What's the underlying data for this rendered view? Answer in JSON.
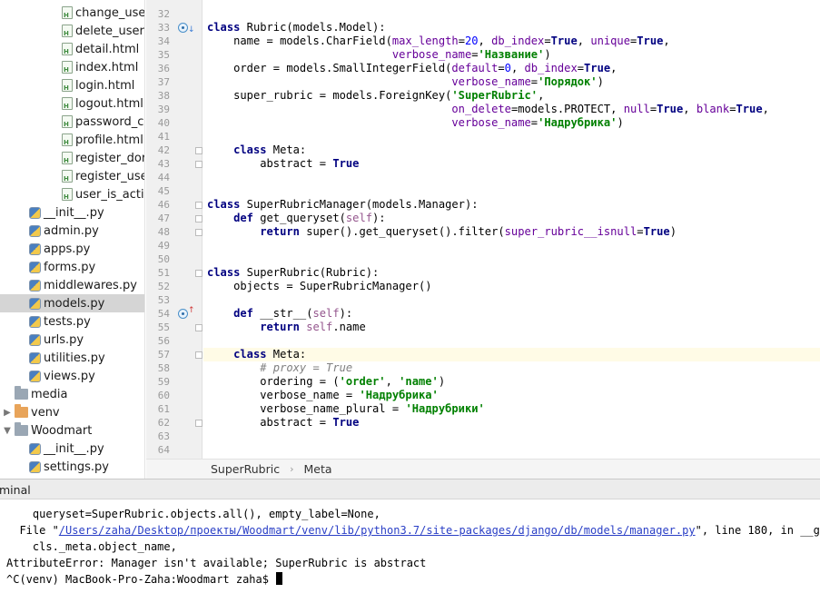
{
  "project_tree": {
    "items": [
      {
        "label": "change_use",
        "type": "html",
        "indent": 3
      },
      {
        "label": "delete_user.",
        "type": "html",
        "indent": 3
      },
      {
        "label": "detail.html",
        "type": "html",
        "indent": 3
      },
      {
        "label": "index.html",
        "type": "html",
        "indent": 3
      },
      {
        "label": "login.html",
        "type": "html",
        "indent": 3
      },
      {
        "label": "logout.html",
        "type": "html",
        "indent": 3
      },
      {
        "label": "password_c",
        "type": "html",
        "indent": 3
      },
      {
        "label": "profile.html",
        "type": "html",
        "indent": 3
      },
      {
        "label": "register_dor",
        "type": "html",
        "indent": 3
      },
      {
        "label": "register_use",
        "type": "html",
        "indent": 3
      },
      {
        "label": "user_is_activ",
        "type": "html",
        "indent": 3
      },
      {
        "label": "__init__.py",
        "type": "py",
        "indent": 2
      },
      {
        "label": "admin.py",
        "type": "py",
        "indent": 2
      },
      {
        "label": "apps.py",
        "type": "py",
        "indent": 2
      },
      {
        "label": "forms.py",
        "type": "py",
        "indent": 2
      },
      {
        "label": "middlewares.py",
        "type": "py",
        "indent": 2
      },
      {
        "label": "models.py",
        "type": "py",
        "indent": 2,
        "selected": true
      },
      {
        "label": "tests.py",
        "type": "py",
        "indent": 2
      },
      {
        "label": "urls.py",
        "type": "py",
        "indent": 2
      },
      {
        "label": "utilities.py",
        "type": "py",
        "indent": 2
      },
      {
        "label": "views.py",
        "type": "py",
        "indent": 2
      },
      {
        "label": "media",
        "type": "folder",
        "indent": 1,
        "arrow": ""
      },
      {
        "label": "venv",
        "type": "folder-orange",
        "indent": 1,
        "arrow": "▶"
      },
      {
        "label": "Woodmart",
        "type": "folder",
        "indent": 1,
        "arrow": "▼"
      },
      {
        "label": "__init__.py",
        "type": "py",
        "indent": 2
      },
      {
        "label": "settings.py",
        "type": "py",
        "indent": 2
      }
    ]
  },
  "editor": {
    "current_line": 57,
    "lines": [
      {
        "n": 32,
        "code": ""
      },
      {
        "n": 33,
        "code": "<span class=\"kw\">class</span> Rubric(models.Model):",
        "mark": "override"
      },
      {
        "n": 34,
        "code": "    name = models.CharField(<span class=\"prm\">max_length</span>=<span class=\"num\">20</span>, <span class=\"prm\">db_index</span>=<span class=\"kw\">True</span>, <span class=\"prm\">unique</span>=<span class=\"kw\">True</span>,"
      },
      {
        "n": 35,
        "code": "                            <span class=\"prm\">verbose_name</span>=<span class=\"str\">'Название'</span>)"
      },
      {
        "n": 36,
        "code": "    order = models.SmallIntegerField(<span class=\"prm\">default</span>=<span class=\"num\">0</span>, <span class=\"prm\">db_index</span>=<span class=\"kw\">True</span>,"
      },
      {
        "n": 37,
        "code": "                                     <span class=\"prm\">verbose_name</span>=<span class=\"str\">'Порядок'</span>)"
      },
      {
        "n": 38,
        "code": "    super_rubric = models.ForeignKey(<span class=\"str\">'SuperRubric'</span>,"
      },
      {
        "n": 39,
        "code": "                                     <span class=\"prm\">on_delete</span>=models.PROTECT, <span class=\"prm\">null</span>=<span class=\"kw\">True</span>, <span class=\"prm\">blank</span>=<span class=\"kw\">True</span>,"
      },
      {
        "n": 40,
        "code": "                                     <span class=\"prm\">verbose_name</span>=<span class=\"str\">'Надрубрика'</span>)"
      },
      {
        "n": 41,
        "code": ""
      },
      {
        "n": 42,
        "code": "    <span class=\"kw\">class</span> Meta:",
        "fold": true
      },
      {
        "n": 43,
        "code": "        abstract = <span class=\"kw\">True</span>",
        "fold": true
      },
      {
        "n": 44,
        "code": ""
      },
      {
        "n": 45,
        "code": ""
      },
      {
        "n": 46,
        "code": "<span class=\"kw\">class</span> SuperRubricManager(models.Manager):",
        "fold": true
      },
      {
        "n": 47,
        "code": "    <span class=\"kw\">def</span> get_queryset(<span class=\"selfkw\">self</span>):",
        "fold": true
      },
      {
        "n": 48,
        "code": "        <span class=\"kw\">return</span> super().get_queryset().filter(<span class=\"prm\">super_rubric__isnull</span>=<span class=\"kw\">True</span>)",
        "fold": true
      },
      {
        "n": 49,
        "code": ""
      },
      {
        "n": 50,
        "code": ""
      },
      {
        "n": 51,
        "code": "<span class=\"kw\">class</span> SuperRubric(Rubric):",
        "fold": true
      },
      {
        "n": 52,
        "code": "    objects = SuperRubricManager()"
      },
      {
        "n": 53,
        "code": ""
      },
      {
        "n": 54,
        "code": "    <span class=\"kw\">def</span> __str__(<span class=\"selfkw\">self</span>):",
        "mark": "overridden"
      },
      {
        "n": 55,
        "code": "        <span class=\"kw\">return</span> <span class=\"selfkw\">self</span>.name",
        "fold": true
      },
      {
        "n": 56,
        "code": ""
      },
      {
        "n": 57,
        "code": "    <span class=\"kw\">class</span> Meta:",
        "fold": true
      },
      {
        "n": 58,
        "code": "        <span class=\"cmt\"># proxy = True</span>"
      },
      {
        "n": 59,
        "code": "        ordering = (<span class=\"str\">'order'</span>, <span class=\"str\">'name'</span>)"
      },
      {
        "n": 60,
        "code": "        verbose_name = <span class=\"str\">'Надрубрика'</span>"
      },
      {
        "n": 61,
        "code": "        verbose_name_plural = <span class=\"str\">'Надрубрики'</span>"
      },
      {
        "n": 62,
        "code": "        abstract = <span class=\"kw\">True</span>",
        "fold": true
      },
      {
        "n": 63,
        "code": ""
      },
      {
        "n": 64,
        "code": ""
      }
    ]
  },
  "breadcrumb": {
    "items": [
      "SuperRubric",
      "Meta"
    ],
    "separator": "›"
  },
  "terminal": {
    "tab_label": "minal",
    "lines": [
      {
        "text": "    queryset=SuperRubric.objects.all(), empty_label=None,"
      },
      {
        "pre": "  File \"",
        "link": "/Users/zaha/Desktop/проекты/Woodmart/venv/lib/python3.7/site-packages/django/db/models/manager.py",
        "post": "\", line 180, in __get__"
      },
      {
        "text": "    cls._meta.object_name,"
      },
      {
        "text": "AttributeError: Manager isn't available; SuperRubric is abstract"
      },
      {
        "text": "^C(venv) MacBook-Pro-Zaha:Woodmart zaha$ ",
        "cursor": true
      }
    ]
  }
}
